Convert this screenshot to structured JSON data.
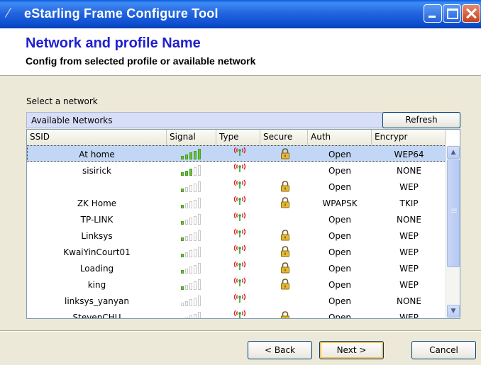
{
  "window": {
    "title": "eStarling Frame Configure Tool"
  },
  "header": {
    "title": "Network and profile Name",
    "subtitle": "Config from selected profile or available network"
  },
  "select_label": "Select a network",
  "available_label": "Available Networks",
  "refresh_label": "Refresh",
  "columns": {
    "ssid": "SSID",
    "signal": "Signal",
    "type": "Type",
    "secure": "Secure",
    "auth": "Auth",
    "encrypt": "Encrypr"
  },
  "networks": [
    {
      "ssid": "At home",
      "signal_bars": 5,
      "secure": true,
      "auth": "Open",
      "encrypt": "WEP64",
      "selected": true
    },
    {
      "ssid": "sisirick",
      "signal_bars": 3,
      "secure": false,
      "auth": "Open",
      "encrypt": "NONE"
    },
    {
      "ssid": "",
      "signal_bars": 1,
      "secure": true,
      "auth": "Open",
      "encrypt": "WEP"
    },
    {
      "ssid": "ZK Home",
      "signal_bars": 1,
      "secure": true,
      "auth": "WPAPSK",
      "encrypt": "TKIP"
    },
    {
      "ssid": "TP-LINK",
      "signal_bars": 1,
      "secure": false,
      "auth": "Open",
      "encrypt": "NONE"
    },
    {
      "ssid": "Linksys",
      "signal_bars": 1,
      "secure": true,
      "auth": "Open",
      "encrypt": "WEP"
    },
    {
      "ssid": "KwaiYinCourt01",
      "signal_bars": 1,
      "secure": true,
      "auth": "Open",
      "encrypt": "WEP"
    },
    {
      "ssid": "Loading",
      "signal_bars": 1,
      "secure": true,
      "auth": "Open",
      "encrypt": "WEP"
    },
    {
      "ssid": "king",
      "signal_bars": 1,
      "secure": true,
      "auth": "Open",
      "encrypt": "WEP"
    },
    {
      "ssid": "linksys_yanyan",
      "signal_bars": 0,
      "secure": false,
      "auth": "Open",
      "encrypt": "NONE"
    },
    {
      "ssid": "StevenCHU",
      "signal_bars": 0,
      "secure": true,
      "auth": "Open",
      "encrypt": "WEP"
    }
  ],
  "buttons": {
    "back": "< Back",
    "next": "Next >",
    "cancel": "Cancel"
  },
  "colors": {
    "title_bar": "#0c4fd0",
    "header_title": "#2020d0",
    "selected_row": "#c1d7f5",
    "signal_on": "#67c23a"
  },
  "icons": {
    "signal": "signal-bars-icon",
    "type": "wireless-antenna-icon",
    "secure": "padlock-icon"
  }
}
